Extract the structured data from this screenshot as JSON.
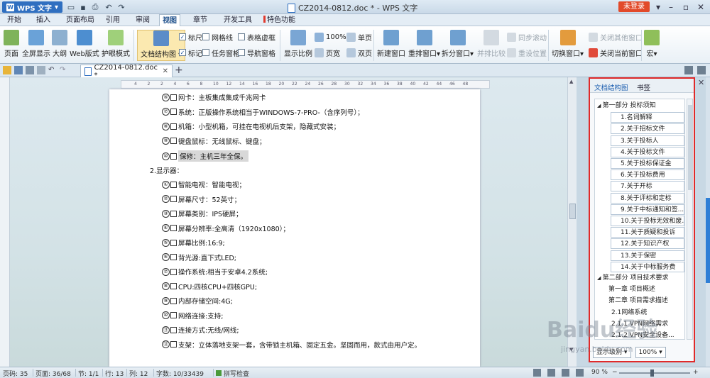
{
  "app": {
    "name": "WPS 文字"
  },
  "window": {
    "title": "CZ2014-0812.doc * - WPS 文字",
    "login_label": "未登录"
  },
  "menu": {
    "tabs": [
      "开始",
      "插入",
      "页面布局",
      "引用",
      "审阅",
      "视图",
      "章节",
      "开发工具",
      "特色功能"
    ],
    "active": "视图"
  },
  "ribbon": {
    "page": "页面",
    "fullscreen": "全屏显示",
    "outline": "大纲",
    "web": "Web版式",
    "eyecare": "护眼模式",
    "docmap": "文档结构图",
    "ruler": "标尺",
    "gridlines": "网格线",
    "table_gridlines": "表格虚框",
    "marks": "标记",
    "taskpane": "任务窗格",
    "navgrid": "导航窗格",
    "zoom": "显示比例",
    "zoom100": "100%",
    "single_page": "单页",
    "page_width": "页宽",
    "two_page": "双页",
    "new_window": "新建窗口",
    "arrange": "重排窗口",
    "split": "拆分窗口",
    "side_by_side": "并排比较",
    "sync_scroll": "同步滚动",
    "reset_pos": "重设位置",
    "switch_window": "切换窗口",
    "close_others": "关闭其他窗口",
    "close_current": "关闭当前窗口",
    "security": "宏"
  },
  "doc_tab": {
    "name": "CZ2014-0812.doc *"
  },
  "ruler_ticks": [
    "4",
    "2",
    "2",
    "4",
    "6",
    "8",
    "10",
    "12",
    "14",
    "16",
    "18",
    "20",
    "22",
    "24",
    "26",
    "28",
    "30",
    "32",
    "34",
    "36",
    "38",
    "40",
    "42",
    "44",
    "46",
    "48"
  ],
  "document": {
    "lines": [
      {
        "num": "⑤",
        "text": "网卡：主板集成集成千兆网卡"
      },
      {
        "num": "⑦",
        "text": "系统：正版操作系统相当于WINDOWS-7-PRO-（含序列号）；"
      },
      {
        "num": "⑧",
        "text": "机箱：小型机箱，可挂在电视机后支架，隐藏式安装；"
      },
      {
        "num": "⑨",
        "text": "键盘鼠标：无线鼠标、键盘；"
      },
      {
        "num": "⑩",
        "text": "保修：主机三年全保。",
        "highlight": true
      },
      {
        "heading": "2.显示器："
      },
      {
        "num": "①",
        "text": "智能电视：智能电视；"
      },
      {
        "num": "②",
        "text": "屏幕尺寸：52英寸；"
      },
      {
        "num": "③",
        "text": "屏幕类别：IPS硬屏；"
      },
      {
        "num": "④",
        "text": "屏幕分辨率:全高清（1920x1080）；"
      },
      {
        "num": "⑤",
        "text": "屏幕比例:16:9;"
      },
      {
        "num": "⑥",
        "text": "背光源:直下式LED;"
      },
      {
        "num": "⑦",
        "text": "操作系统:相当于安卓4.2系统;"
      },
      {
        "num": "⑧",
        "text": "CPU:四核CPU+四核GPU;"
      },
      {
        "num": "⑨",
        "text": "内部存储空间:4G;"
      },
      {
        "num": "⑩",
        "text": "网络连接:支持;"
      },
      {
        "num": "⑪",
        "text": "连接方式:无线/网线;"
      },
      {
        "num": "⑫",
        "text": "支架：立体落地支架一套，含带锁主机箱、固定五金。坚固而用，款式由用户定。"
      }
    ]
  },
  "nav": {
    "tab_docmap": "文档结构图",
    "tab_bookmark": "书签",
    "items": [
      {
        "level": 1,
        "text": "第一部分    投标须知"
      },
      {
        "level": 2,
        "text": "1.名词解释"
      },
      {
        "level": 2,
        "text": "2.关于招标文件"
      },
      {
        "level": 2,
        "text": "3.关于投标人"
      },
      {
        "level": 2,
        "text": "4.关于投标文件"
      },
      {
        "level": 2,
        "text": "5.关于投标保证金"
      },
      {
        "level": 2,
        "text": "6.关于投标费用"
      },
      {
        "level": 2,
        "text": "7.关于开标"
      },
      {
        "level": 2,
        "text": "8.关于评标和定标"
      },
      {
        "level": 2,
        "text": "9.关于中标通知和签..."
      },
      {
        "level": 2,
        "text": "10.关于投标无效和废..."
      },
      {
        "level": 2,
        "text": "11.关于质疑和投诉"
      },
      {
        "level": 2,
        "text": "12.关于知识产权"
      },
      {
        "level": 2,
        "text": "13.关于保密"
      },
      {
        "level": 2,
        "text": "14.关于中标服务费"
      },
      {
        "level": 1,
        "text": "第二部分    项目技术要求"
      },
      {
        "level": "ch",
        "text": "第一章 项目概述"
      },
      {
        "level": "ch",
        "text": "第二章  项目需求描述"
      },
      {
        "level": 3,
        "text": "2.1网络系统"
      },
      {
        "level": 3,
        "text": "2.1.1 VPN网络需求"
      },
      {
        "level": 3,
        "text": "2.1.2 VPN安全设备..."
      }
    ],
    "show_level": "显示级别",
    "zoom": "100%"
  },
  "status": {
    "page_code": "页码: 35",
    "pages": "页面: 36/68",
    "section": "节: 1/1",
    "row": "行: 13",
    "col": "列: 12",
    "words": "字数: 10/33439",
    "spell": "拼写检查",
    "zoom": "90 %"
  },
  "watermark": {
    "brand": "Baidu经验",
    "url": "jingyan.baidu.com"
  },
  "colors": {
    "accent": "#2f6fc0",
    "highlight_border": "#e02a2a",
    "login": "#e24a2a"
  }
}
